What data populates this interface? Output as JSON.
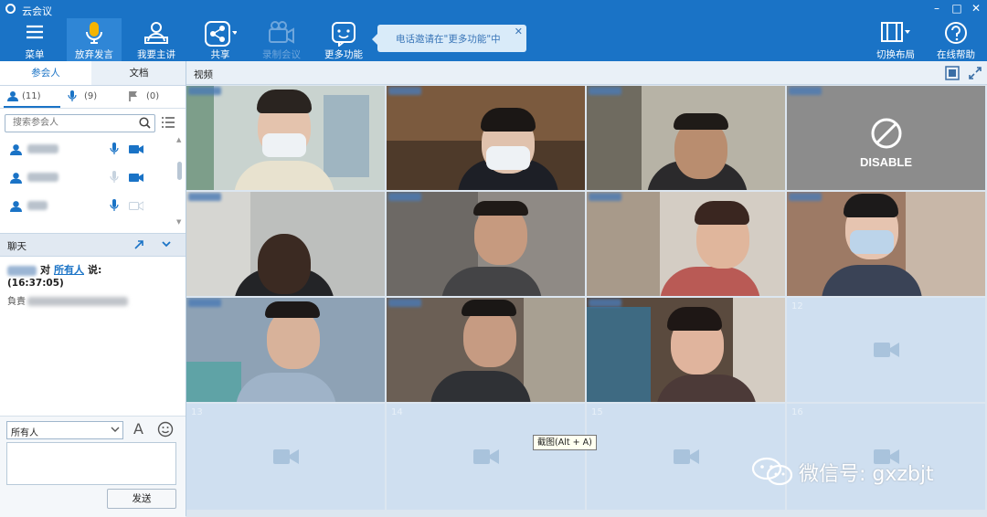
{
  "app": {
    "title": "云会议"
  },
  "toolbar": {
    "menu": "菜单",
    "give_up_speaking": "放弃发言",
    "host": "我要主讲",
    "share": "共享",
    "record": "录制会议",
    "more": "更多功能",
    "layout": "切换布局",
    "help": "在线帮助"
  },
  "tip": {
    "text": "电话邀请在\"更多功能\"中"
  },
  "sidebar": {
    "tabs": [
      "参会人",
      "文档"
    ],
    "filters": {
      "all": "(11)",
      "speaking": "(9)",
      "raised": "(0)"
    },
    "search_placeholder": "搜索参会人"
  },
  "chat": {
    "title": "聊天",
    "verb_to": "对",
    "recipient": "所有人",
    "verb_say": "说:",
    "time": "(16:37:05)",
    "content_prefix": "負責",
    "target_select": "所有人",
    "send": "发送"
  },
  "video": {
    "title": "视频",
    "disabled_label": "DISABLE",
    "empty_slots": [
      "12",
      "13",
      "14",
      "15",
      "16"
    ]
  },
  "tooltip": {
    "text": "截图(Alt + A)"
  },
  "watermark": {
    "text": "微信号: gxzbjt"
  },
  "colors": {
    "primary": "#1a73c6",
    "panel": "#e9f0f7",
    "empty_tile": "#cfdff0"
  }
}
